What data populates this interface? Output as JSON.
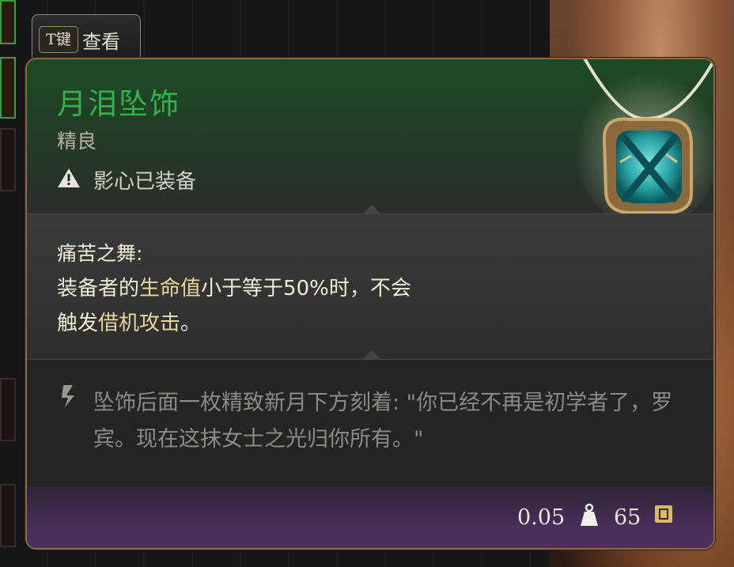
{
  "tab": {
    "key": "T键",
    "label": "查看"
  },
  "item": {
    "name": "月泪坠饰",
    "rarity": "精良",
    "equipped_by": "影心已装备",
    "name_color": "#33b24a",
    "icon": "pendant-icon"
  },
  "passive": {
    "title": "痛苦之舞:",
    "desc_parts": [
      "装备者的",
      "生命值",
      "小于等于50%时，不会",
      "触发",
      "借机攻击",
      "。"
    ]
  },
  "lore": "坠饰后面一枚精致新月下方刻着: \"你已经不再是初学者了，罗宾。现在这抹女士之光归你所有。\"",
  "footer": {
    "weight": "0.05",
    "price": "65",
    "weight_icon": "weight-icon",
    "price_icon": "gold-icon"
  }
}
